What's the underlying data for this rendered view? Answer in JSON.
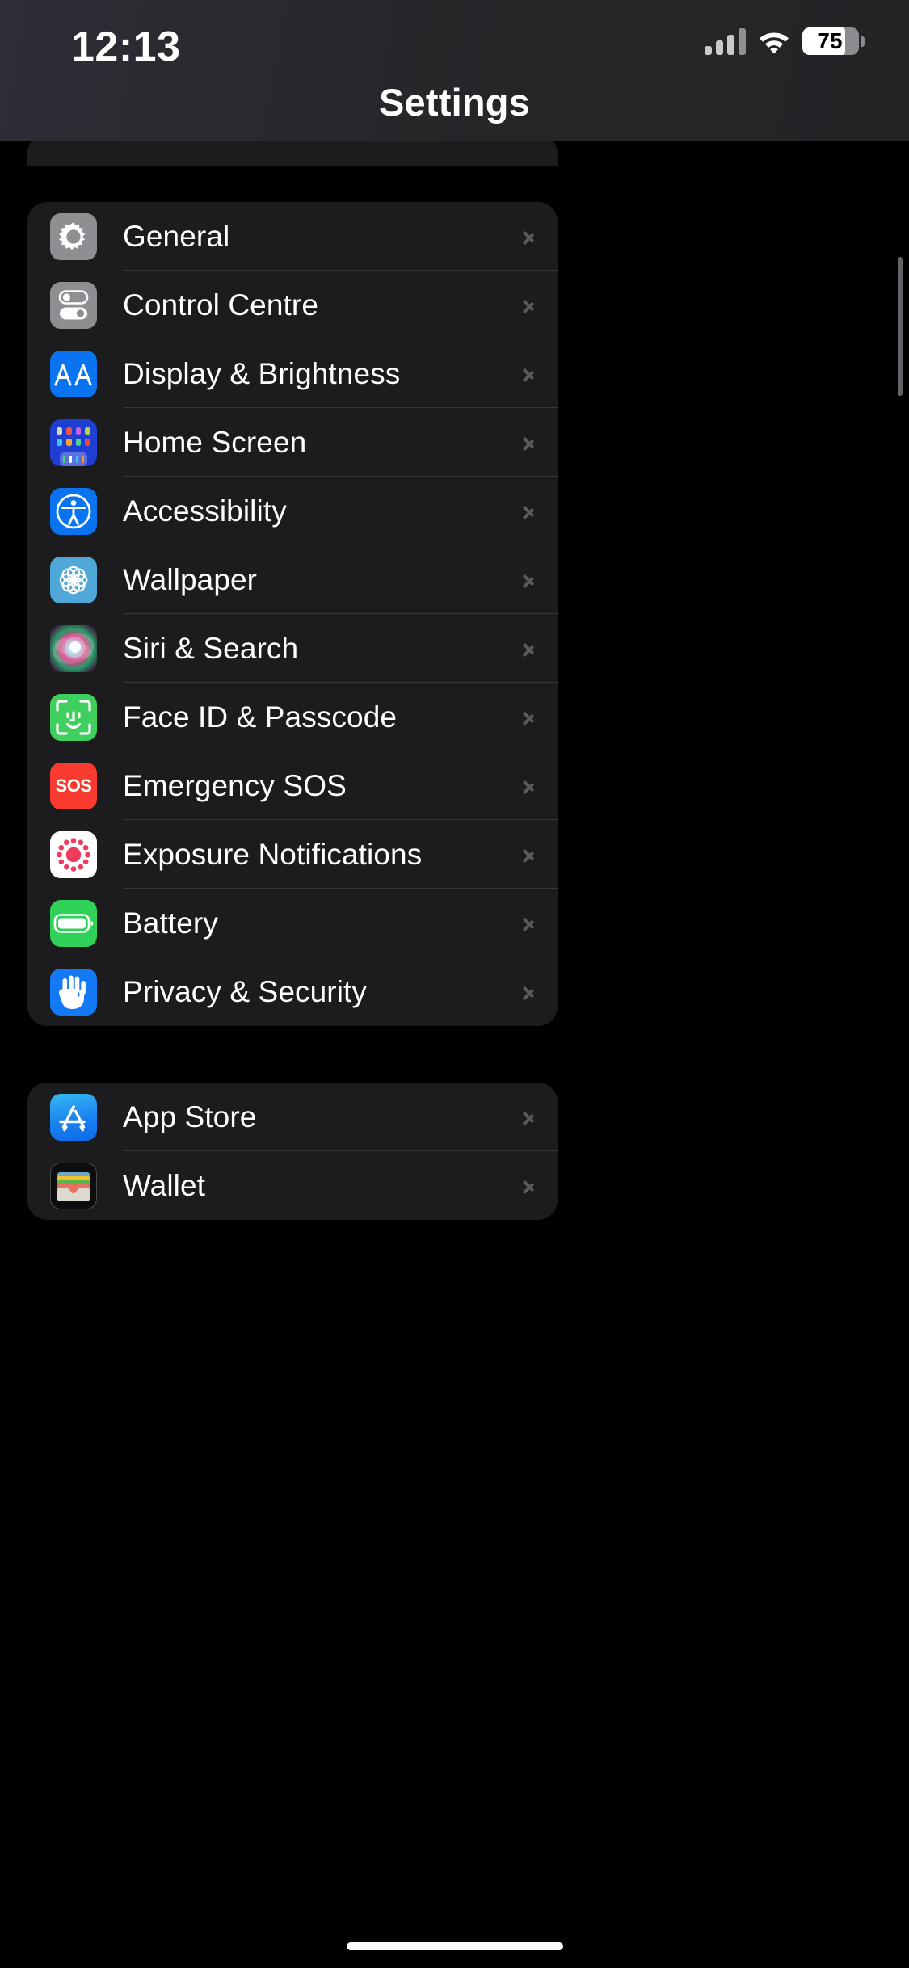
{
  "status_bar": {
    "time": "12:13",
    "cellular_icon": "cellular-bars-icon",
    "cellular_bars_active": 3,
    "wifi_icon": "wifi-icon",
    "battery_icon": "battery-icon",
    "battery_percent": "75",
    "battery_level": 75
  },
  "header": {
    "title": "Settings"
  },
  "colors": {
    "background": "#000000",
    "card": "#1c1c1e",
    "separator": "#38383a",
    "label": "#ffffff",
    "chevron": "#5a5a5e",
    "accent_blue": "#0a74f0",
    "green": "#30d158",
    "red": "#f83a2f",
    "gray": "#8e8e93"
  },
  "groups": [
    {
      "name": "system-settings-group",
      "rows": [
        {
          "label": "General",
          "icon": "gear-icon",
          "icon_class": "ic-gear",
          "chevron": "chevron-right-icon"
        },
        {
          "label": "Control Centre",
          "icon": "control-centre-toggles-icon",
          "icon_class": "ic-cc",
          "chevron": "chevron-right-icon"
        },
        {
          "label": "Display & Brightness",
          "icon": "display-brightness-aa-icon",
          "icon_class": "ic-aa",
          "chevron": "chevron-right-icon"
        },
        {
          "label": "Home Screen",
          "icon": "home-screen-grid-icon",
          "icon_class": "ic-home",
          "chevron": "chevron-right-icon"
        },
        {
          "label": "Accessibility",
          "icon": "accessibility-person-icon",
          "icon_class": "ic-acc",
          "chevron": "chevron-right-icon"
        },
        {
          "label": "Wallpaper",
          "icon": "wallpaper-flower-icon",
          "icon_class": "ic-wall",
          "chevron": "chevron-right-icon"
        },
        {
          "label": "Siri & Search",
          "icon": "siri-orb-icon",
          "icon_class": "ic-siri",
          "chevron": "chevron-right-icon"
        },
        {
          "label": "Face ID & Passcode",
          "icon": "face-id-icon",
          "icon_class": "ic-face",
          "chevron": "chevron-right-icon"
        },
        {
          "label": "Emergency SOS",
          "icon": "sos-icon",
          "icon_class": "ic-sos",
          "chevron": "chevron-right-icon"
        },
        {
          "label": "Exposure Notifications",
          "icon": "exposure-notifications-icon",
          "icon_class": "ic-exp",
          "chevron": "chevron-right-icon"
        },
        {
          "label": "Battery",
          "icon": "battery-icon",
          "icon_class": "ic-batt",
          "chevron": "chevron-right-icon"
        },
        {
          "label": "Privacy & Security",
          "icon": "privacy-hand-icon",
          "icon_class": "ic-priv",
          "chevron": "chevron-right-icon"
        }
      ]
    },
    {
      "name": "store-group",
      "rows": [
        {
          "label": "App Store",
          "icon": "app-store-icon",
          "icon_class": "ic-apps",
          "chevron": "chevron-right-icon"
        },
        {
          "label": "Wallet",
          "icon": "wallet-icon",
          "icon_class": "ic-wlt",
          "chevron": "chevron-right-icon"
        }
      ]
    }
  ],
  "home_screen_icon_colors": {
    "row1": [
      "#d8d8d0",
      "#f4554f",
      "#c761e8",
      "#b8d044"
    ],
    "row2": [
      "#3ec5ef",
      "#f7a72b",
      "#4fd693",
      "#f4453a"
    ],
    "dock": [
      "#52d86a",
      "#ffffff",
      "#3ec5ef",
      "#f9992e"
    ]
  },
  "wallet_card_colors": [
    "#6fa8c4",
    "#f0c22c",
    "#58b84c",
    "#e8705e",
    "#ded9d0"
  ],
  "scrollbar": {
    "name": "vertical-scroll-indicator"
  },
  "home_indicator": {
    "name": "home-indicator"
  }
}
